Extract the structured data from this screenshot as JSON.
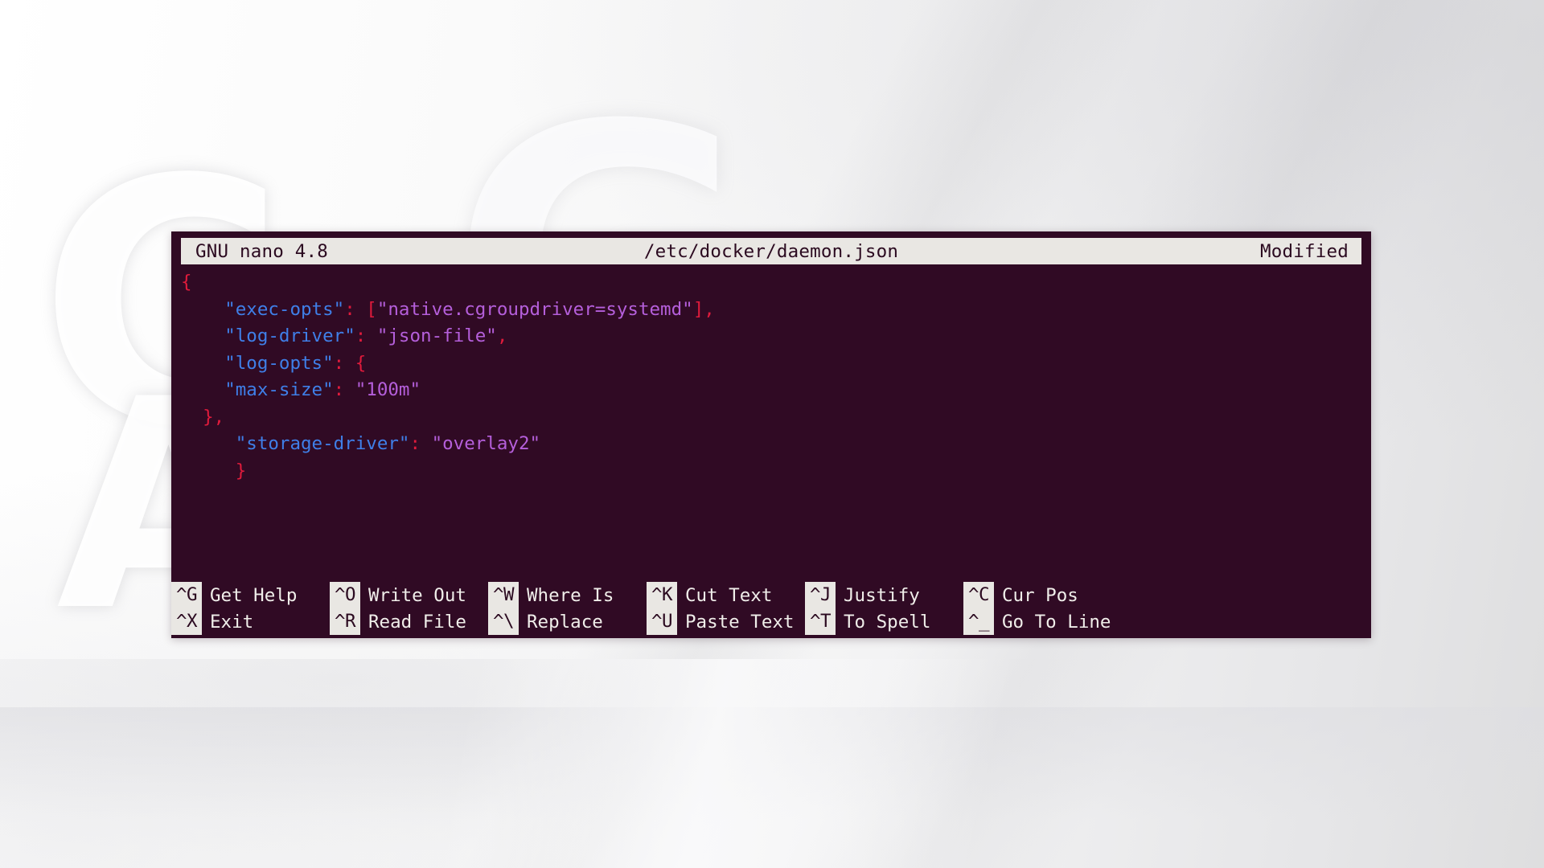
{
  "editor": {
    "app_name": "GNU nano",
    "version": "4.8",
    "title_version_label": "GNU nano 4.8",
    "filename": "/etc/docker/daemon.json",
    "status": "Modified",
    "colors": {
      "background": "#300a24",
      "titlebar_bg": "#e9e7e3",
      "titlebar_fg": "#2b0a20",
      "punctuation": "#e01b3c",
      "key": "#3f7fe8",
      "string": "#b55fdb",
      "default_text": "#d8d8d8"
    },
    "lines": [
      [
        {
          "t": "{",
          "c": "punct"
        }
      ],
      [
        {
          "t": "    ",
          "c": "plain"
        },
        {
          "t": "\"exec-opts\"",
          "c": "key"
        },
        {
          "t": ":",
          "c": "colon"
        },
        {
          "t": " ",
          "c": "plain"
        },
        {
          "t": "[",
          "c": "punct"
        },
        {
          "t": "\"native.cgroupdriver=systemd\"",
          "c": "string"
        },
        {
          "t": "]",
          "c": "punct"
        },
        {
          "t": ",",
          "c": "punct"
        }
      ],
      [
        {
          "t": "    ",
          "c": "plain"
        },
        {
          "t": "\"log-driver\"",
          "c": "key"
        },
        {
          "t": ":",
          "c": "colon"
        },
        {
          "t": " ",
          "c": "plain"
        },
        {
          "t": "\"json-file\"",
          "c": "string"
        },
        {
          "t": ",",
          "c": "punct"
        }
      ],
      [
        {
          "t": "    ",
          "c": "plain"
        },
        {
          "t": "\"log-opts\"",
          "c": "key"
        },
        {
          "t": ":",
          "c": "colon"
        },
        {
          "t": " ",
          "c": "plain"
        },
        {
          "t": "{",
          "c": "punct"
        }
      ],
      [
        {
          "t": "    ",
          "c": "plain"
        },
        {
          "t": "\"max-size\"",
          "c": "key"
        },
        {
          "t": ":",
          "c": "colon"
        },
        {
          "t": " ",
          "c": "plain"
        },
        {
          "t": "\"100m\"",
          "c": "string"
        }
      ],
      [
        {
          "t": "  ",
          "c": "plain"
        },
        {
          "t": "},",
          "c": "punct"
        }
      ],
      [
        {
          "t": "     ",
          "c": "plain"
        },
        {
          "t": "\"storage-driver\"",
          "c": "key"
        },
        {
          "t": ":",
          "c": "colon"
        },
        {
          "t": " ",
          "c": "plain"
        },
        {
          "t": "\"overlay2\"",
          "c": "string"
        }
      ],
      [
        {
          "t": "     ",
          "c": "plain"
        },
        {
          "t": "}",
          "c": "punct"
        }
      ],
      [
        {
          "t": "",
          "c": "plain"
        }
      ],
      [
        {
          "t": "",
          "c": "plain"
        }
      ]
    ],
    "plain_text": "{\n    \"exec-opts\": [\"native.cgroupdriver=systemd\"],\n    \"log-driver\": \"json-file\",\n    \"log-opts\": {\n    \"max-size\": \"100m\"\n  },\n     \"storage-driver\": \"overlay2\"\n     }"
  },
  "help_bar": {
    "row1": [
      {
        "key": "^G",
        "label": "Get Help"
      },
      {
        "key": "^O",
        "label": "Write Out"
      },
      {
        "key": "^W",
        "label": "Where Is"
      },
      {
        "key": "^K",
        "label": "Cut Text"
      },
      {
        "key": "^J",
        "label": "Justify"
      },
      {
        "key": "^C",
        "label": "Cur Pos"
      }
    ],
    "row2": [
      {
        "key": "^X",
        "label": "Exit"
      },
      {
        "key": "^R",
        "label": "Read File"
      },
      {
        "key": "^\\",
        "label": "Replace"
      },
      {
        "key": "^U",
        "label": "Paste Text"
      },
      {
        "key": "^T",
        "label": "To Spell"
      },
      {
        "key": "^_",
        "label": "Go To Line"
      }
    ]
  },
  "watermark": {
    "glyph_c": "C",
    "glyph_a": "A",
    "glyph_g": "G"
  }
}
